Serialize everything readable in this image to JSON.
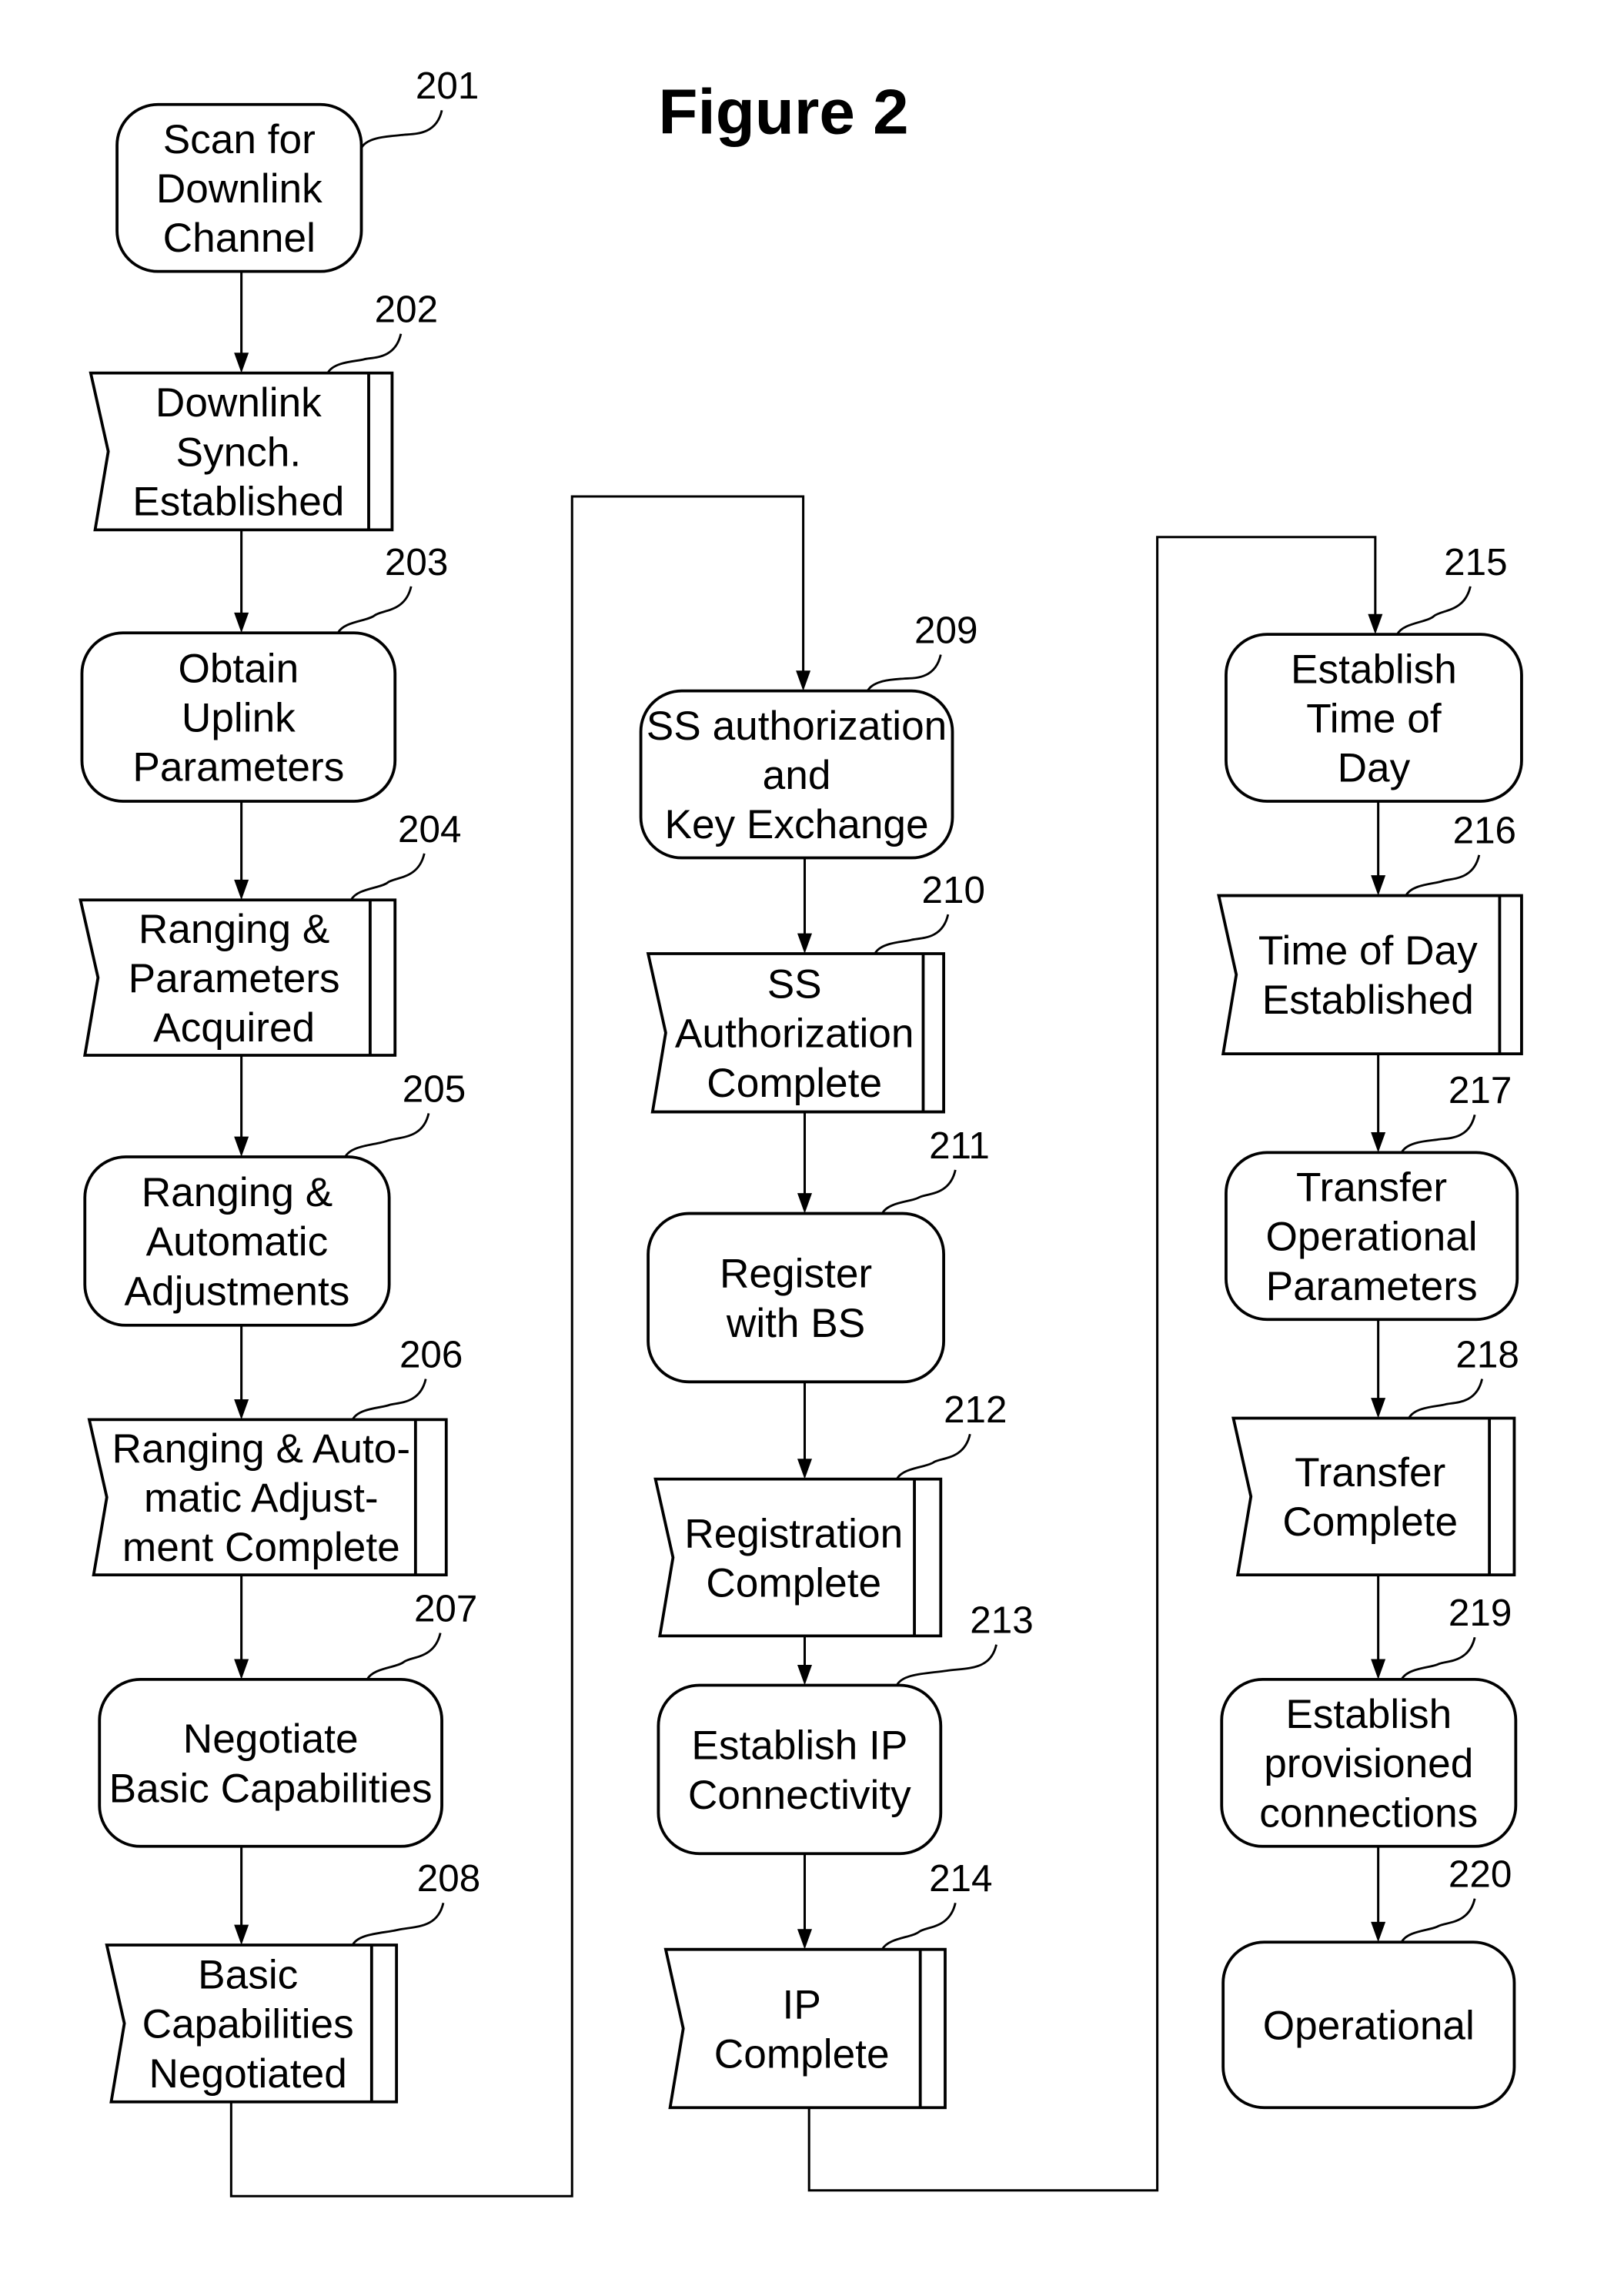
{
  "figure": {
    "title": "Figure 2",
    "steps": [
      {
        "ref": "201",
        "type": "process",
        "lines": [
          "Scan for",
          "Downlink",
          "Channel"
        ]
      },
      {
        "ref": "202",
        "type": "state",
        "lines": [
          "Downlink",
          "Synch.",
          "Established"
        ]
      },
      {
        "ref": "203",
        "type": "process",
        "lines": [
          "Obtain",
          "Uplink",
          "Parameters"
        ]
      },
      {
        "ref": "204",
        "type": "state",
        "lines": [
          "Ranging &",
          "Parameters",
          "Acquired"
        ]
      },
      {
        "ref": "205",
        "type": "process",
        "lines": [
          "Ranging &",
          "Automatic",
          "Adjustments"
        ]
      },
      {
        "ref": "206",
        "type": "state",
        "lines": [
          "Ranging & Auto-",
          "matic Adjust-",
          "ment Complete"
        ]
      },
      {
        "ref": "207",
        "type": "process",
        "lines": [
          "Negotiate",
          "Basic Capabilities"
        ]
      },
      {
        "ref": "208",
        "type": "state",
        "lines": [
          "Basic",
          "Capabilities",
          "Negotiated"
        ]
      },
      {
        "ref": "209",
        "type": "process",
        "lines": [
          "SS authorization",
          "and",
          "Key Exchange"
        ]
      },
      {
        "ref": "210",
        "type": "state",
        "lines": [
          "SS",
          "Authorization",
          "Complete"
        ]
      },
      {
        "ref": "211",
        "type": "process",
        "lines": [
          "Register",
          "with BS"
        ]
      },
      {
        "ref": "212",
        "type": "state",
        "lines": [
          "Registration",
          "Complete"
        ]
      },
      {
        "ref": "213",
        "type": "process",
        "lines": [
          "Establish IP",
          "Connectivity"
        ]
      },
      {
        "ref": "214",
        "type": "state",
        "lines": [
          "IP",
          "Complete"
        ]
      },
      {
        "ref": "215",
        "type": "process",
        "lines": [
          "Establish",
          "Time of",
          "Day"
        ]
      },
      {
        "ref": "216",
        "type": "state",
        "lines": [
          "Time of Day",
          "Established"
        ]
      },
      {
        "ref": "217",
        "type": "process",
        "lines": [
          "Transfer",
          "Operational",
          "Parameters"
        ]
      },
      {
        "ref": "218",
        "type": "state",
        "lines": [
          "Transfer",
          "Complete"
        ]
      },
      {
        "ref": "219",
        "type": "process",
        "lines": [
          "Establish",
          "provisioned",
          "connections"
        ]
      },
      {
        "ref": "220",
        "type": "process",
        "lines": [
          "Operational"
        ]
      }
    ],
    "flow": [
      "201",
      "202",
      "203",
      "204",
      "205",
      "206",
      "207",
      "208",
      "209",
      "210",
      "211",
      "212",
      "213",
      "214",
      "215",
      "216",
      "217",
      "218",
      "219",
      "220"
    ]
  }
}
